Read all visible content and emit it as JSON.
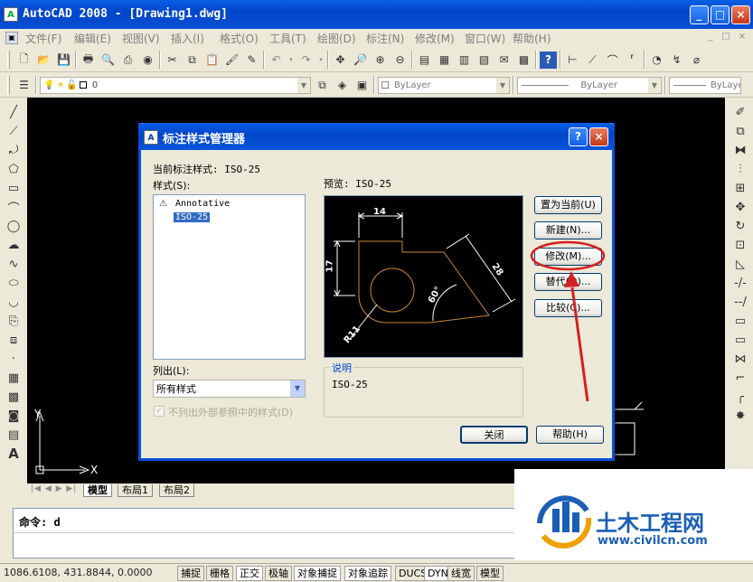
{
  "app": {
    "title": "AutoCAD 2008 - [Drawing1.dwg]",
    "icon_text": "A"
  },
  "window_controls": {
    "minimize": "_",
    "maximize": "□",
    "close": "×"
  },
  "doc_controls": {
    "minimize": "_",
    "restore": "□",
    "close": "×"
  },
  "menu": [
    "文件(F)",
    "编辑(E)",
    "视图(V)",
    "插入(I)",
    "格式(O)",
    "工具(T)",
    "绘图(D)",
    "标注(N)",
    "修改(M)",
    "窗口(W)",
    "帮助(H)"
  ],
  "layer_toolbar": {
    "layer_value": "0",
    "color_value": "ByLayer",
    "linetype_value": "ByLayer",
    "lineweight_value": "ByLayer"
  },
  "tabs": {
    "model": "模型",
    "layout1": "布局1",
    "layout2": "布局2"
  },
  "ucs": {
    "x_label": "X",
    "y_label": "Y"
  },
  "command": {
    "prompt": "命令: d"
  },
  "status": {
    "coords": "1086.6108, 431.8844, 0.0000",
    "buttons": [
      "捕捉",
      "栅格",
      "正交",
      "极轴",
      "对象捕捉",
      "对象追踪",
      "DUCS",
      "DYN",
      "线宽",
      "模型"
    ]
  },
  "dialog": {
    "title": "标注样式管理器",
    "icon_text": "A",
    "help_btn": "?",
    "close_btn": "×",
    "current_style_label": "当前标注样式: ISO-25",
    "styles_label": "样式(S):",
    "styles": [
      "Annotative",
      "ISO-25"
    ],
    "selected_style": "ISO-25",
    "preview_label": "预览: ISO-25",
    "list_label": "列出(L):",
    "list_value": "所有样式",
    "xref_checkbox": "不列出外部参照中的样式(D)",
    "description_label": "说明",
    "description_value": "ISO-25",
    "buttons": {
      "set_current": "置为当前(U)",
      "new": "新建(N)...",
      "modify": "修改(M)...",
      "override": "替代(O)...",
      "compare": "比较(C)...",
      "close": "关闭",
      "help": "帮助(H)"
    },
    "preview_dims": {
      "top": "14",
      "left": "17",
      "diag": "28",
      "angle": "60°",
      "radius": "R11"
    }
  },
  "watermark": {
    "brand": "土木工程网",
    "url": "www.civilcn.com"
  },
  "colors": {
    "xp_blue": "#0a4fd5",
    "annotation_red": "#d42020",
    "preview_geometry": "#c88a3a",
    "preview_dims": "#ffffff",
    "watermark_blue": "#1a5fb4"
  }
}
